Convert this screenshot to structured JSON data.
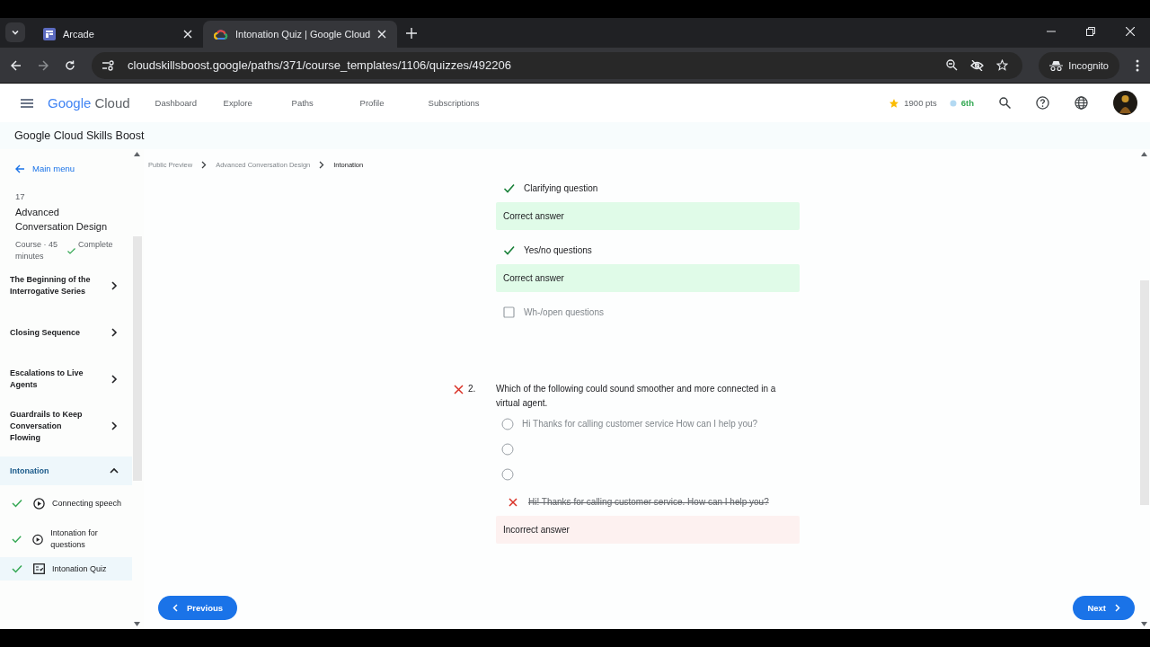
{
  "browser": {
    "tabs": [
      {
        "title": "Arcade",
        "selected": false,
        "kind": "arcade"
      },
      {
        "title": "Intonation Quiz | Google Cloud",
        "selected": true,
        "kind": "cloud"
      }
    ],
    "url": "cloudskillsboost.google/paths/371/course_templates/1106/quizzes/492206",
    "profile": "Incognito"
  },
  "header": {
    "logo_word_1": "Google",
    "logo_word_2": "Cloud",
    "nav": [
      "Dashboard",
      "Explore",
      "Paths",
      "Profile",
      "Subscriptions"
    ],
    "points": "1900 pts",
    "rank": "6th"
  },
  "site_title": "Google Cloud Skills Boost",
  "sidebar": {
    "back_link": "Main menu",
    "course_number": "17",
    "course_title": "Advanced Conversation Design",
    "meta": "Course · 45 minutes",
    "status": "Complete",
    "sections": [
      {
        "label": "The Beginning of the Interrogative Series",
        "expanded": false,
        "selected": false
      },
      {
        "label": "Closing Sequence",
        "expanded": false,
        "selected": false
      },
      {
        "label": "Escalations to Live Agents",
        "expanded": false,
        "selected": false
      },
      {
        "label": "Guardrails to Keep Conversation Flowing",
        "expanded": false,
        "selected": false
      },
      {
        "label": "Intonation",
        "expanded": true,
        "selected": true,
        "children": [
          {
            "label": "Connecting speech",
            "kind": "video",
            "done": true,
            "selected": false
          },
          {
            "label": "Intonation for questions",
            "kind": "video",
            "done": true,
            "selected": false
          },
          {
            "label": "Intonation Quiz",
            "kind": "quiz",
            "done": true,
            "selected": true
          }
        ]
      }
    ]
  },
  "breadcrumb": [
    "Public Preview",
    "Advanced Conversation Design",
    "Intonation"
  ],
  "question_1_options": [
    {
      "label": "Clarifying question",
      "checked": true,
      "feedback": "Correct answer"
    },
    {
      "label": "Yes/no questions",
      "checked": true,
      "feedback": "Correct answer"
    },
    {
      "label": "Wh-/open questions",
      "checked": false
    }
  ],
  "question_2": {
    "number": "2.",
    "correct": false,
    "text": "Which of the following could sound smoother and more connected in a virtual agent.",
    "options": [
      {
        "label": "Hi Thanks for calling customer service How can I help you?",
        "selected": false
      },
      {
        "selected": false
      },
      {
        "selected": false
      }
    ],
    "chosen_answer": "Hi! Thanks for calling customer service. How can I help you?",
    "feedback": "Incorrect answer"
  },
  "buttons": {
    "previous": "Previous",
    "next": "Next"
  }
}
